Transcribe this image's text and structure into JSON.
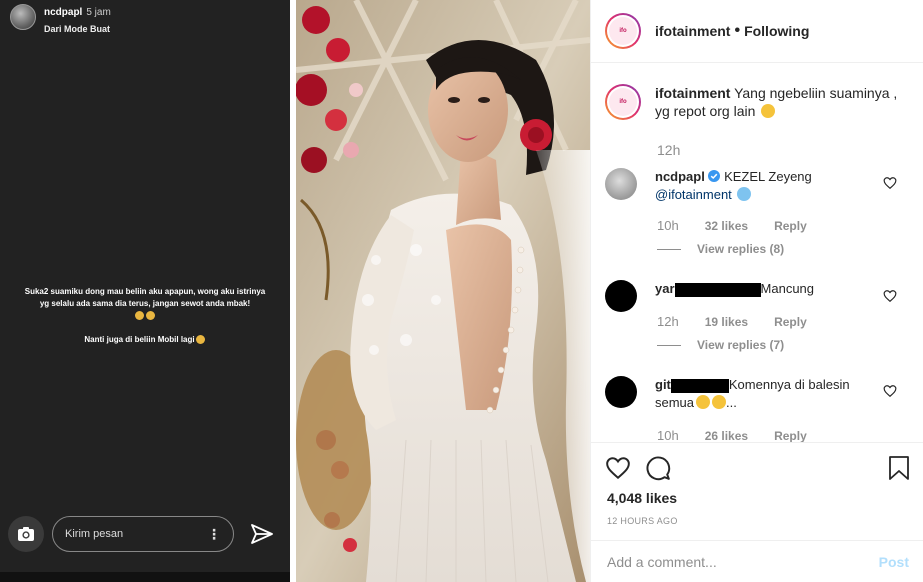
{
  "story": {
    "username": "ncdpapl",
    "time": "5 jam",
    "subtitle": "Dari Mode Buat",
    "text_line1": "Suka2 suamiku dong mau beliin aku apapun, wong aku istrinya yg selalu ada sama dia terus, jangan sewot anda mbak!",
    "text_line2": "Nanti juga di beliin Mobil lagi",
    "reply_placeholder": "Kirim pesan"
  },
  "post": {
    "author": "ifotainment",
    "follow_status": "Following",
    "caption": "Yang ngebeliin suaminya , yg repot org lain",
    "caption_age": "12h",
    "likes": "4,048 likes",
    "timestamp": "12 HOURS AGO"
  },
  "comments": [
    {
      "user": "ncdpapl",
      "text": "KEZEL Zeyeng",
      "mention": "@ifotainment",
      "age": "10h",
      "likes": "32 likes",
      "reply": "Reply",
      "view_replies": "View replies (8)"
    },
    {
      "user": "yar",
      "text": "Mancung",
      "age": "12h",
      "likes": "19 likes",
      "reply": "Reply",
      "view_replies": "View replies (7)"
    },
    {
      "user": "git",
      "text": "Komennya di balesin semua",
      "text_tail": "...",
      "age": "10h",
      "likes": "26 likes",
      "reply": "Reply"
    }
  ],
  "add_comment": {
    "placeholder": "Add a comment...",
    "post_label": "Post"
  },
  "colors": {
    "link": "#003569",
    "muted": "#8e8e8e",
    "verified": "#3897f0",
    "post_disabled": "#b2dffc"
  },
  "icons": [
    "camera-icon",
    "more-icon",
    "send-icon",
    "heart-icon",
    "comment-icon",
    "bookmark-icon",
    "verified-badge-icon"
  ]
}
